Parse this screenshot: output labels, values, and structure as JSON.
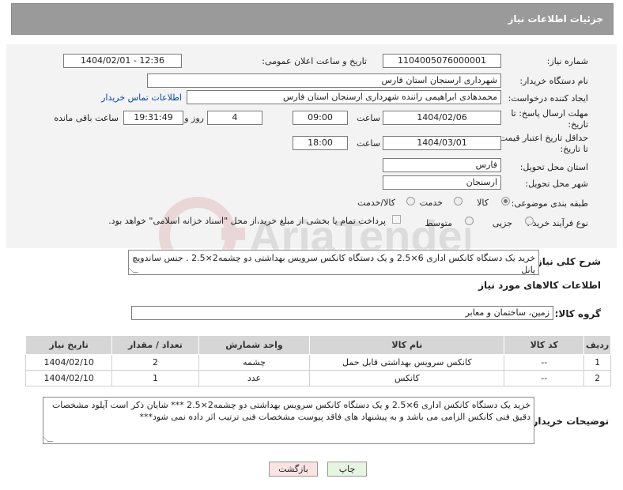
{
  "header": {
    "title": "جزئیات اطلاعات نیاز"
  },
  "form": {
    "need_number_label": "شماره نیاز:",
    "need_number": "1104005076000001",
    "announce_label": "تاریخ و ساعت اعلان عمومی:",
    "announce_value": "1404/02/01 - 12:36",
    "buyer_org_label": "نام دستگاه خریدار:",
    "buyer_org": "شهرداری ارسنجان استان فارس",
    "requester_label": "ایجاد کننده درخواست:",
    "requester": "محمدهادی ابراهیمی راننده شهرداری ارسنجان استان فارس",
    "contact_link": "اطلاعات تماس خریدار",
    "deadline_label": "مهلت ارسال پاسخ: تا تاریخ:",
    "deadline_date": "1404/02/06",
    "time_label": "ساعت",
    "deadline_time": "09:00",
    "days_value": "4",
    "days_label": "روز و",
    "remaining_time": "19:31:49",
    "remaining_label": "ساعت باقی مانده",
    "price_validity_label": "حداقل تاریخ اعتبار قیمت: تا تاریخ:",
    "price_validity_date": "1404/03/01",
    "price_validity_time": "18:00",
    "province_label": "استان محل تحویل:",
    "province": "فارس",
    "city_label": "شهر محل تحویل:",
    "city": "ارسنجان",
    "category_label": "طبقه بندی موضوعی:",
    "category_options": [
      "کالا",
      "خدمت",
      "کالا/خدمت"
    ],
    "process_label": "نوع فرآیند خرید :",
    "process_options": [
      "جزیی",
      "متوسط"
    ],
    "payment_note": "پرداخت تمام یا بخشی از مبلغ خرید،از محل \"اسناد خزانه اسلامی\" خواهد بود."
  },
  "description": {
    "label": "شرح کلی نیاز:",
    "text": "خرید یک دستگاه کانکس اداری 6×2.5 و یک دستگاه کانکس سرویس بهداشتی دو چشمه2×2.5 . جنس ساندویچ پانل"
  },
  "goods_info": {
    "title": "اطلاعات کالاهای مورد نیاز",
    "group_label": "گروه کالا:",
    "group_value": "زمین، ساختمان و معابر"
  },
  "table": {
    "headers": [
      "ردیف",
      "کد کالا",
      "نام کالا",
      "واحد شمارش",
      "تعداد / مقدار",
      "تاریخ نیاز"
    ],
    "rows": [
      [
        "1",
        "--",
        "کانکس سرویس بهداشتی قابل حمل",
        "چشمه",
        "2",
        "1404/02/10"
      ],
      [
        "2",
        "--",
        "کانکس",
        "عدد",
        "1",
        "1404/02/10"
      ]
    ]
  },
  "buyer_notes": {
    "label": "توضیحات خریدار:",
    "text": "خرید یک دستگاه کانکس اداری 6×2.5 و یک دستگاه کانکس سرویس بهداشتی دو چشمه2×2.5 *** شایان ذکر است آپلود مشخصات دقیق فنی کانکس الزامی می باشد و به پیشنهاد های فاقد پیوست مشخصات فنی ترتیب اثر داده نمی شود***"
  },
  "buttons": {
    "print": "چاپ",
    "back": "بازگشت"
  },
  "watermark_text": "AriaTender.neT",
  "colors": {
    "header_bg": "#9a9a9a",
    "panel_bg": "#f3f3f3",
    "link": "#0645ad",
    "print_btn": "#e6f5e0",
    "back_btn": "#fbe3e3"
  }
}
